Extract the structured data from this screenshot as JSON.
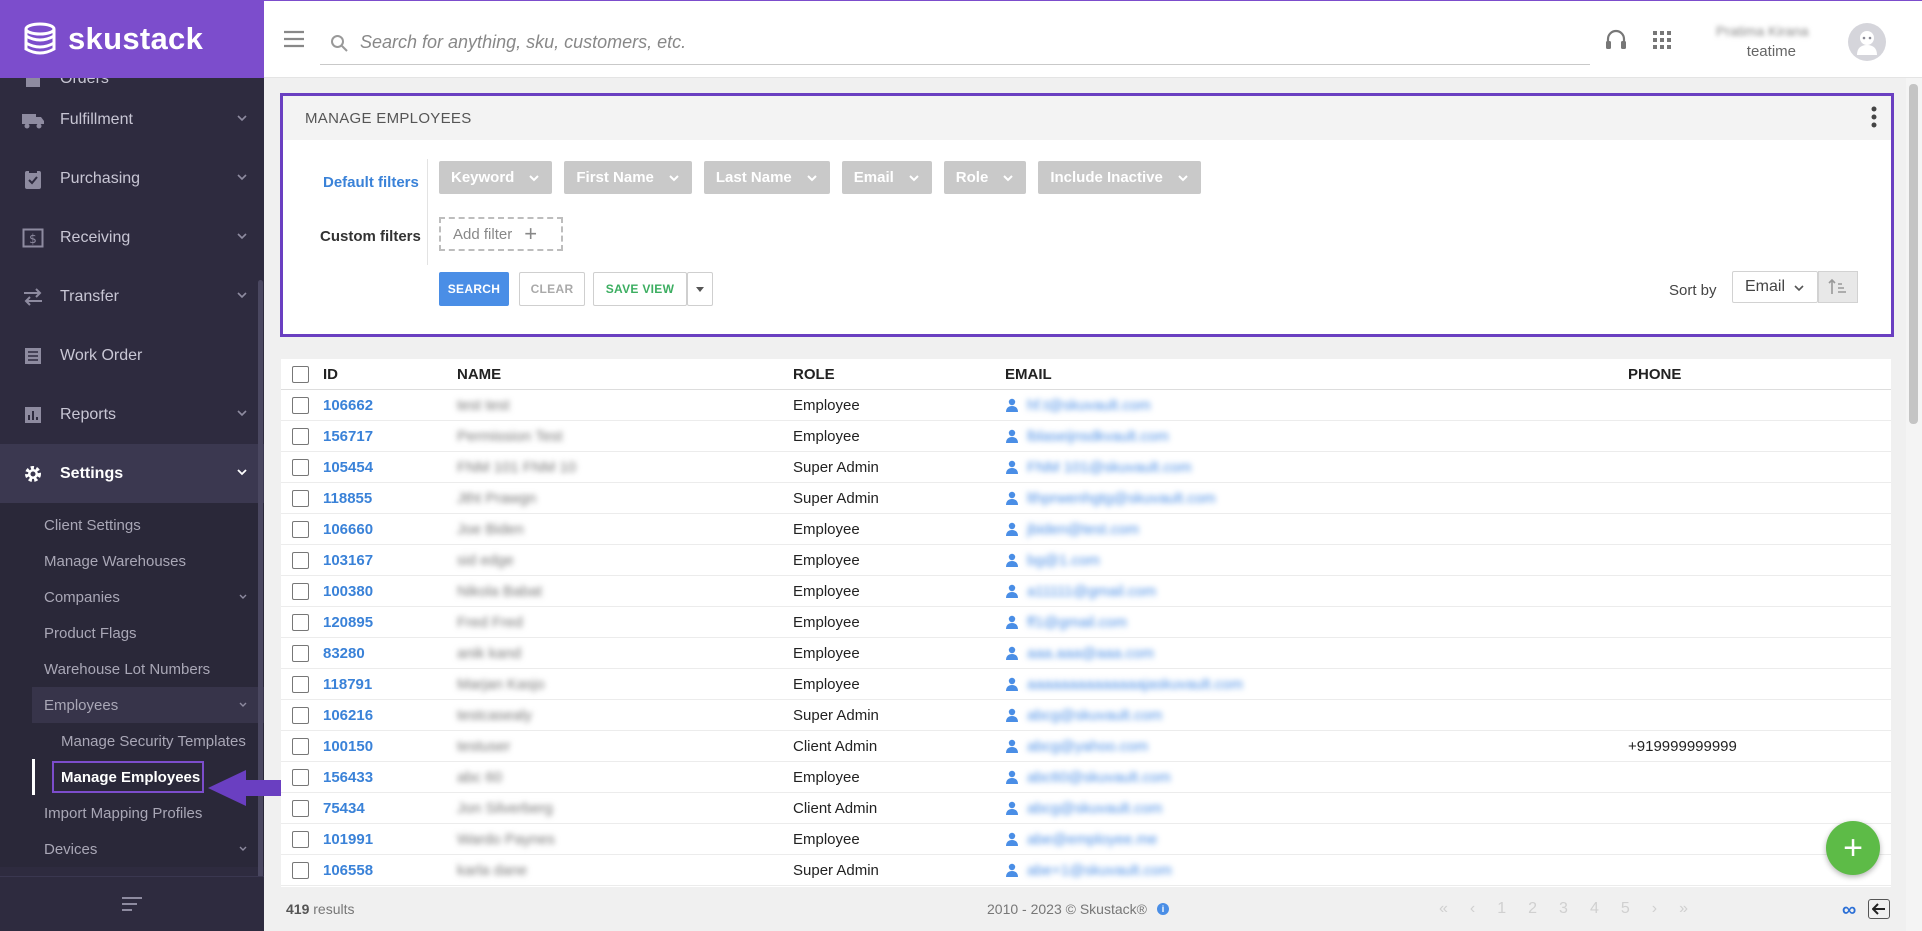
{
  "brand": {
    "name": "skustack"
  },
  "search": {
    "placeholder": "Search for anything, sku, customers, etc."
  },
  "user": {
    "name": "Pratima Kirana",
    "tenant": "teatime"
  },
  "nav": {
    "items": [
      {
        "label": "Orders",
        "icon": "orders-icon"
      },
      {
        "label": "Fulfillment",
        "icon": "truck-icon"
      },
      {
        "label": "Purchasing",
        "icon": "clipboard-icon"
      },
      {
        "label": "Receiving",
        "icon": "dollar-box-icon"
      },
      {
        "label": "Transfer",
        "icon": "transfer-icon"
      },
      {
        "label": "Work Order",
        "icon": "list-icon"
      },
      {
        "label": "Reports",
        "icon": "bar-chart-icon"
      },
      {
        "label": "Settings",
        "icon": "gear-icon"
      }
    ],
    "settings_sub": [
      "Client Settings",
      "Manage Warehouses",
      "Companies",
      "Product Flags",
      "Warehouse Lot Numbers",
      "Employees",
      "Manage Security Templates",
      "Manage Employees",
      "Import Mapping Profiles",
      "Devices"
    ]
  },
  "panel": {
    "title": "MANAGE EMPLOYEES",
    "default_filters_label": "Default filters",
    "custom_filters_label": "Custom filters",
    "chips": [
      "Keyword",
      "First Name",
      "Last Name",
      "Email",
      "Role",
      "Include Inactive"
    ],
    "add_filter": "Add filter",
    "search_btn": "SEARCH",
    "clear_btn": "CLEAR",
    "save_view_btn": "SAVE VIEW",
    "sort_label": "Sort by",
    "sort_value": "Email"
  },
  "table": {
    "headers": {
      "id": "ID",
      "name": "NAME",
      "role": "ROLE",
      "email": "EMAIL",
      "phone": "PHONE"
    },
    "rows": [
      {
        "id": "106662",
        "name": "test test",
        "role": "Employee",
        "email": "hf.t@skuvault.com",
        "phone": ""
      },
      {
        "id": "156717",
        "name": "Permission Test",
        "role": "Employee",
        "email": "lblaseijnsdkvault.com",
        "phone": ""
      },
      {
        "id": "105454",
        "name": "FNM 101 FNM 10",
        "role": "Super Admin",
        "email": "FNM 101@skuvault.com",
        "phone": ""
      },
      {
        "id": "118855",
        "name": "Jtht Prawgn",
        "role": "Super Admin",
        "email": "lthprwenhgtg@skuvault.com",
        "phone": ""
      },
      {
        "id": "106660",
        "name": "Joe Biden",
        "role": "Employee",
        "email": "jbiden@test.com",
        "phone": ""
      },
      {
        "id": "103167",
        "name": "sid edge",
        "role": "Employee",
        "email": "bg@1.com",
        "phone": ""
      },
      {
        "id": "100380",
        "name": "Nikola Babat",
        "role": "Employee",
        "email": "a11111@gmail.com",
        "phone": ""
      },
      {
        "id": "120895",
        "name": "Fred Fred",
        "role": "Employee",
        "email": "ff1@gmail.com",
        "phone": ""
      },
      {
        "id": "83280",
        "name": "anik kand",
        "role": "Employee",
        "email": "aaa.aaa@aaa.com",
        "phone": ""
      },
      {
        "id": "118791",
        "name": "Marjan Kasjo",
        "role": "Employee",
        "email": "aaaaaaaaaaaaaajaskuvault.com",
        "phone": ""
      },
      {
        "id": "106216",
        "name": "testcasealy",
        "role": "Super Admin",
        "email": "abcg@skuvault.com",
        "phone": ""
      },
      {
        "id": "100150",
        "name": "testuser",
        "role": "Client Admin",
        "email": "abcg@yahoo.com",
        "phone": "+919999999999"
      },
      {
        "id": "156433",
        "name": "abc 60",
        "role": "Employee",
        "email": "abc60@skuvault.com",
        "phone": ""
      },
      {
        "id": "75434",
        "name": "Jon Silverberg",
        "role": "Client Admin",
        "email": "abcg@skuvault.com",
        "phone": ""
      },
      {
        "id": "101991",
        "name": "Wardo Paynes",
        "role": "Employee",
        "email": "abe@employee.me",
        "phone": ""
      },
      {
        "id": "106558",
        "name": "karla dane",
        "role": "Super Admin",
        "email": "abe+1@skuvault.com",
        "phone": ""
      }
    ]
  },
  "footer": {
    "results_count": "419",
    "results_label": "results",
    "copyright": "2010 - 2023 © Skustack®",
    "pages": [
      "1",
      "2",
      "3",
      "4",
      "5"
    ]
  },
  "colors": {
    "brand": "#7c4dcc",
    "link": "#3a82d8",
    "fab": "#5dbb47",
    "save": "#3cae61"
  }
}
